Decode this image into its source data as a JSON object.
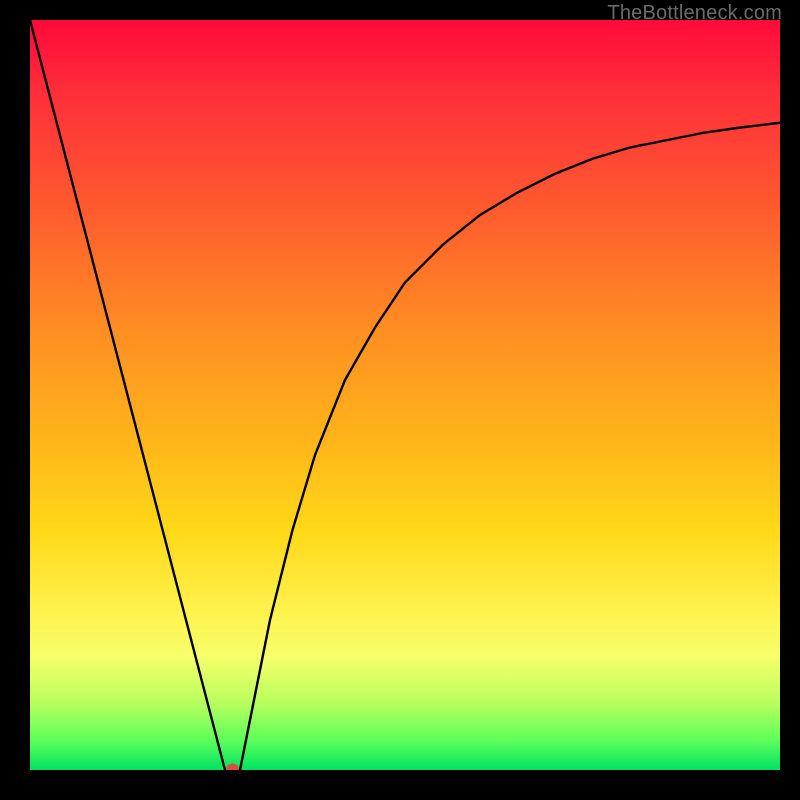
{
  "watermark": "TheBottleneck.com",
  "chart_data": {
    "type": "line",
    "title": "",
    "xlabel": "",
    "ylabel": "",
    "xlim": [
      0,
      100
    ],
    "ylim": [
      0,
      100
    ],
    "grid": false,
    "note": "Axes are unlabeled; values are estimated from pixel proportions (0–100 scale).",
    "left_segment": {
      "x": [
        0,
        26
      ],
      "y": [
        100,
        0
      ]
    },
    "right_segment": {
      "comment": "Rises steeply from the dip then flattens toward an asymptote near y≈86.",
      "x": [
        28,
        30,
        32,
        35,
        38,
        42,
        46,
        50,
        55,
        60,
        65,
        70,
        75,
        80,
        85,
        90,
        95,
        100
      ],
      "y": [
        0,
        10,
        20,
        32,
        42,
        52,
        59,
        65,
        70,
        74,
        77,
        79.5,
        81.5,
        83,
        84,
        85,
        85.7,
        86.3
      ]
    },
    "minimum_marker": {
      "x": 27,
      "y": 0,
      "color": "#d94f3c"
    },
    "background_gradient": {
      "top": "#ff0a3a",
      "bottom": "#00e262",
      "description": "Vertical rainbow gradient from red (high) through orange/yellow to green (low)."
    }
  }
}
